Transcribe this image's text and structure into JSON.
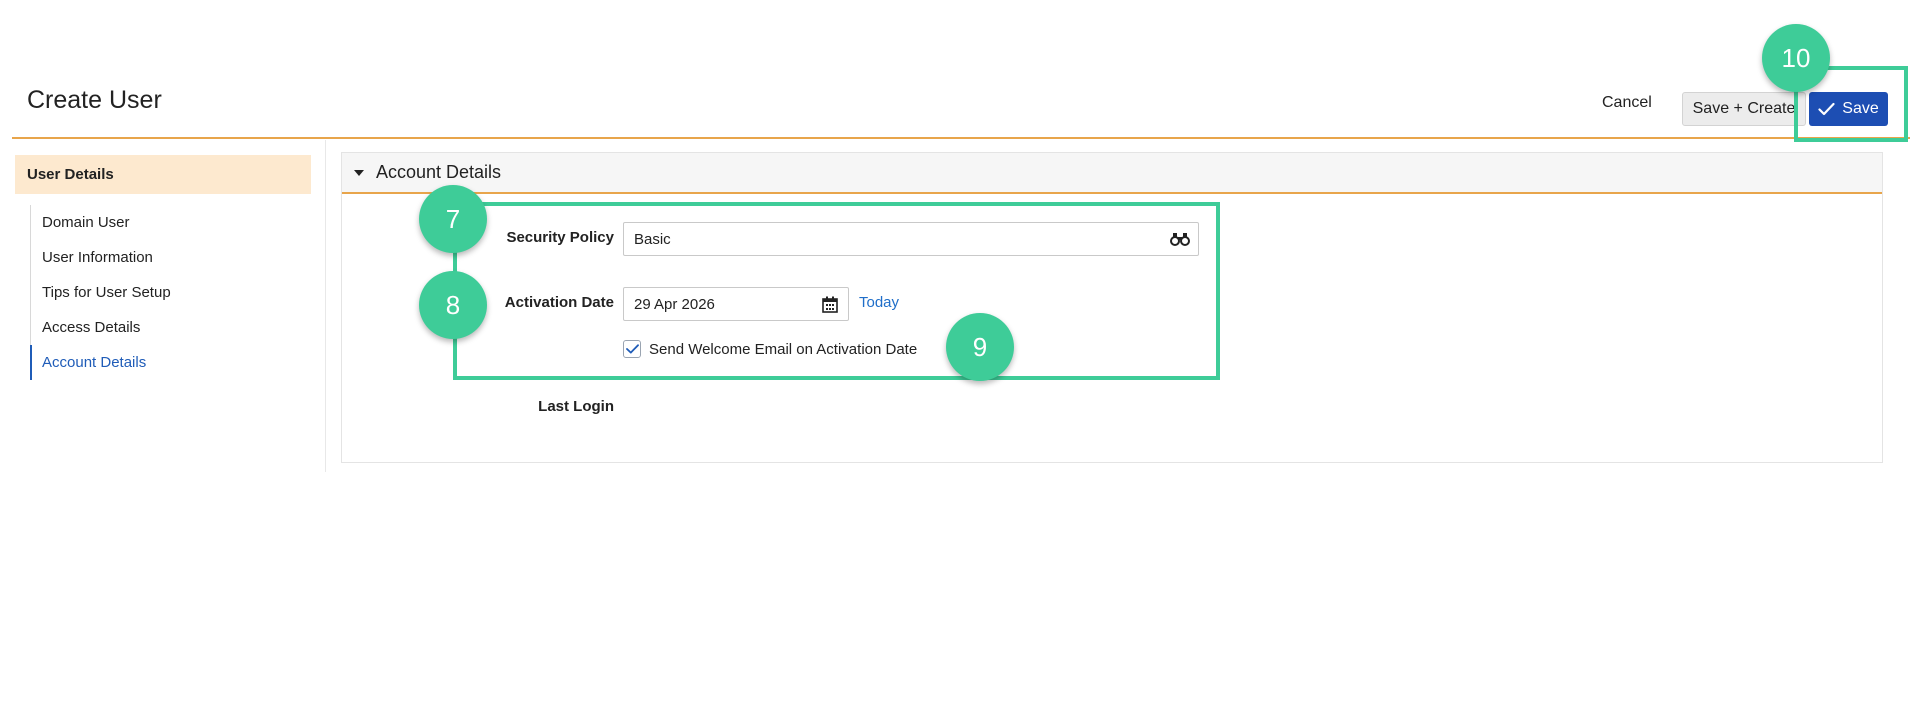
{
  "header": {
    "title": "Create User",
    "cancel_label": "Cancel",
    "save_create_label": "Save + Create",
    "save_label": "Save"
  },
  "sidebar": {
    "header": "User Details",
    "items": [
      {
        "label": "Domain User"
      },
      {
        "label": "User Information"
      },
      {
        "label": "Tips for User Setup"
      },
      {
        "label": "Access Details"
      },
      {
        "label": "Account Details",
        "active": true
      }
    ]
  },
  "panel": {
    "title": "Account Details",
    "security_policy": {
      "label": "Security Policy",
      "value": "Basic"
    },
    "activation_date": {
      "label": "Activation Date",
      "value": "29 Apr 2026",
      "today_label": "Today"
    },
    "welcome_email": {
      "label": "Send Welcome Email on Activation Date",
      "checked": true
    },
    "last_login": {
      "label": "Last Login"
    }
  },
  "annotations": {
    "badges": [
      "7",
      "8",
      "9",
      "10"
    ]
  },
  "colors": {
    "accent_orange": "#e8a54b",
    "primary_blue": "#1d4eb3",
    "link_blue": "#1f6ec9",
    "annotation_green": "#3ecc98",
    "sidebar_header_bg": "#fde9cf"
  },
  "icons": {
    "panel_toggle": "caret-down-icon",
    "lookup": "binoculars-icon",
    "date_picker": "calendar-icon",
    "checkbox": "checkmark-icon",
    "save": "checkmark-icon"
  }
}
